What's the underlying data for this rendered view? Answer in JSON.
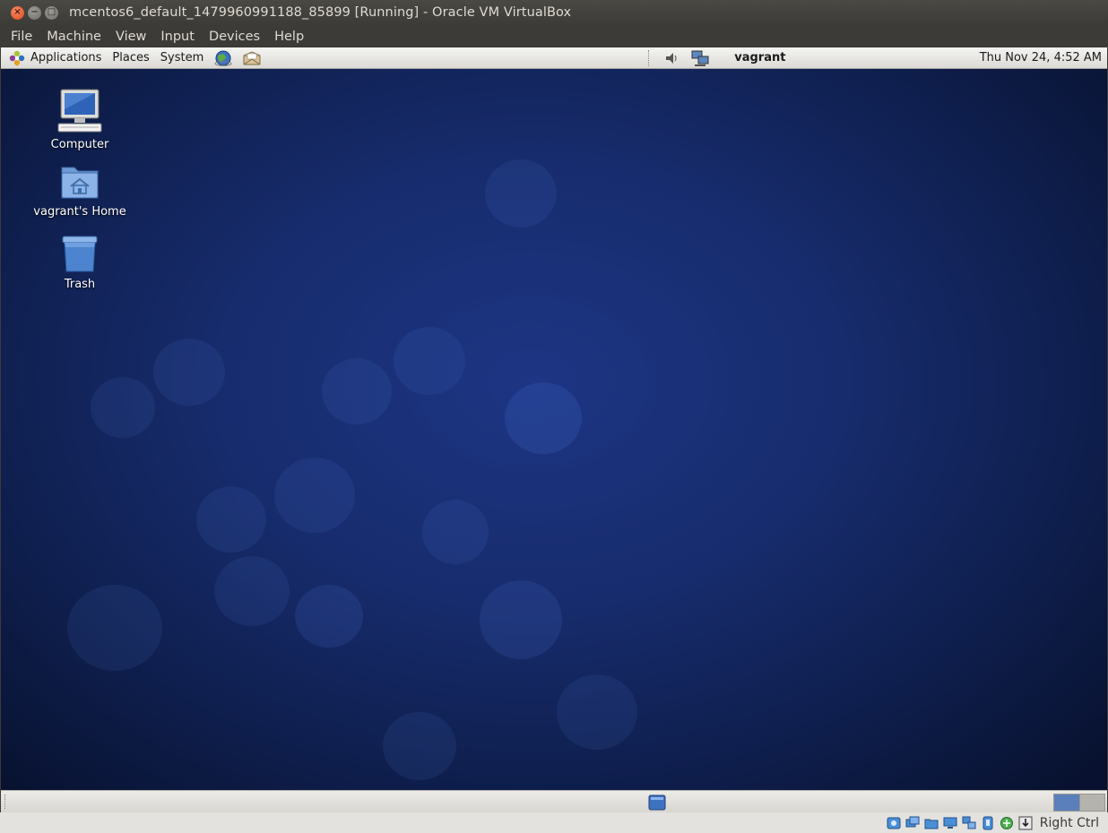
{
  "window": {
    "title": "mcentos6_default_1479960991188_85899 [Running] - Oracle VM VirtualBox",
    "controls": [
      "close",
      "minimize",
      "maximize"
    ]
  },
  "vbox_menu": [
    "File",
    "Machine",
    "View",
    "Input",
    "Devices",
    "Help"
  ],
  "gnome_panel": {
    "menus": [
      "Applications",
      "Places",
      "System"
    ],
    "launchers": [
      "web-browser-icon",
      "mail-client-icon"
    ],
    "tray": [
      "volume-icon",
      "network-icon"
    ],
    "user": "vagrant",
    "clock": "Thu Nov 24,  4:52 AM"
  },
  "desktop": {
    "icons": [
      {
        "label": "Computer",
        "icon": "computer-icon"
      },
      {
        "label": "vagrant's Home",
        "icon": "home-folder-icon"
      },
      {
        "label": "Trash",
        "icon": "trash-icon"
      }
    ]
  },
  "bottom_panel": {
    "workspaces": 2,
    "active_workspace": 1
  },
  "statusbar": {
    "icons": [
      "hard-disk-icon",
      "optical-drive-icon",
      "shared-folders-icon",
      "display-icon",
      "network-adapter-icon",
      "usb-icon",
      "capture-icon",
      "mouse-integration-icon"
    ],
    "host_key": "Right Ctrl"
  },
  "colors": {
    "titlebar": "#3c3b37",
    "close_button": "#df4a16",
    "desktop_blue": "#1d3584",
    "panel": "#edece9"
  }
}
